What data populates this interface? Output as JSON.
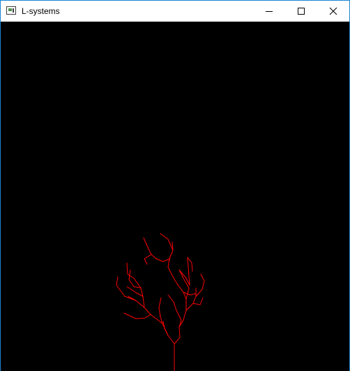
{
  "window": {
    "title": "L-systems",
    "border_color": "#1883d7"
  },
  "titlebar": {
    "app_icon": "app-window-icon",
    "buttons": [
      {
        "name": "minimize",
        "icon": "minimize-icon"
      },
      {
        "name": "maximize",
        "icon": "maximize-icon"
      },
      {
        "name": "close",
        "icon": "close-icon"
      }
    ]
  },
  "canvas": {
    "background_color": "#000000",
    "stroke_color": "#ff0000",
    "content": "l-system-tree"
  }
}
